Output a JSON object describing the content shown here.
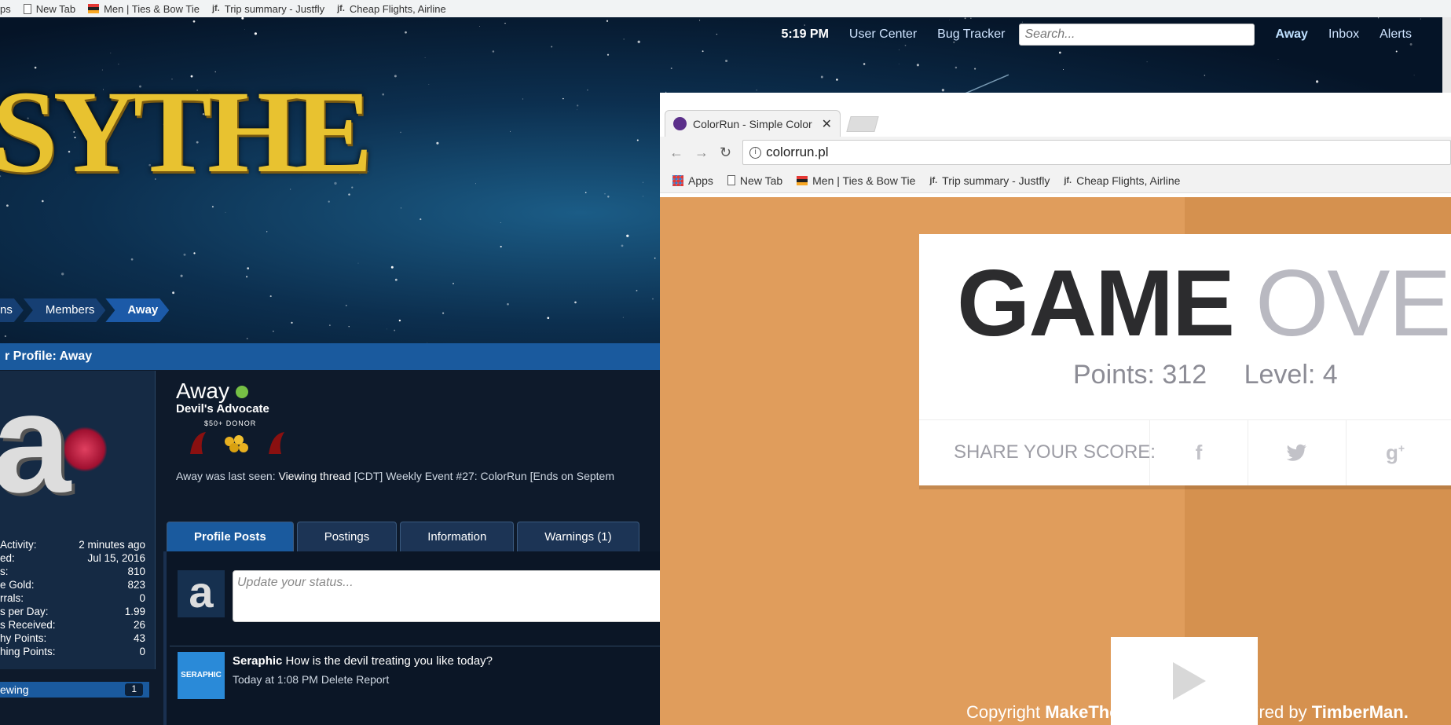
{
  "top_bookmarks": [
    "ps",
    "New Tab",
    "Men | Ties & Bow Tie",
    "Trip summary - Justfly",
    "Cheap Flights, Airline"
  ],
  "forum": {
    "logo_text": "SYTHE",
    "nav": {
      "time": "5:19 PM",
      "user_center": "User Center",
      "bug_tracker": "Bug Tracker",
      "search_placeholder": "Search...",
      "away": "Away",
      "inbox": "Inbox",
      "alerts": "Alerts"
    },
    "breadcrumb": [
      "ns",
      "Members",
      "Away"
    ],
    "profile_header": "r Profile: Away",
    "stats": [
      {
        "label": "Activity:",
        "value": "2 minutes ago"
      },
      {
        "label": "ed:",
        "value": "Jul 15, 2016"
      },
      {
        "label": "s:",
        "value": "810"
      },
      {
        "label": "e Gold:",
        "value": "823"
      },
      {
        "label": "rrals:",
        "value": "0"
      },
      {
        "label": "s per Day:",
        "value": "1.99"
      },
      {
        "label": "s Received:",
        "value": "26"
      },
      {
        "label": "hy Points:",
        "value": "43"
      },
      {
        "label": "hing Points:",
        "value": "0"
      }
    ],
    "viewing_label": "ewing",
    "viewing_count": "1",
    "username": "Away",
    "user_title": "Devil's Advocate",
    "donor_text": "$50+  DONOR",
    "last_seen_prefix": "Away was last seen:",
    "last_seen_action": "Viewing thread",
    "last_seen_thread": "[CDT] Weekly Event #27: ColorRun [Ends on Septem",
    "tabs": [
      "Profile Posts",
      "Postings",
      "Information",
      "Warnings (1)"
    ],
    "status_placeholder": "Update your status...",
    "post": {
      "author": "Seraphic",
      "message": "How is the devil treating you like today?",
      "time": "Today at 1:08 PM",
      "delete": "Delete",
      "report": "Report",
      "avatar_text": "SERAPHIC"
    }
  },
  "chrome": {
    "tab_title": "ColorRun - Simple Color",
    "url": "colorrun.pl",
    "bookmarks": [
      "Apps",
      "New Tab",
      "Men | Ties & Bow Tie",
      "Trip summary - Justfly",
      "Cheap Flights, Airline"
    ]
  },
  "game": {
    "title_bold": "GAME",
    "title_light": "OVER",
    "points_label": "Points:",
    "points": "312",
    "level_label": "Level:",
    "level": "4",
    "share_label": "SHARE YOUR SCORE:",
    "share_icons": [
      "facebook-icon",
      "twitter-icon",
      "google-plus-icon"
    ],
    "copyright_prefix": "Copyright",
    "copyright_brand": "MakeTheWeb.",
    "inspired_prefix": "Inspired by",
    "inspired_brand": "TimberMan."
  },
  "colors": {
    "game_bg": "#e09d5c",
    "game_stripe": "#d5914f",
    "forum_blue": "#1a5a9e",
    "logo_gold": "#e8c230"
  }
}
